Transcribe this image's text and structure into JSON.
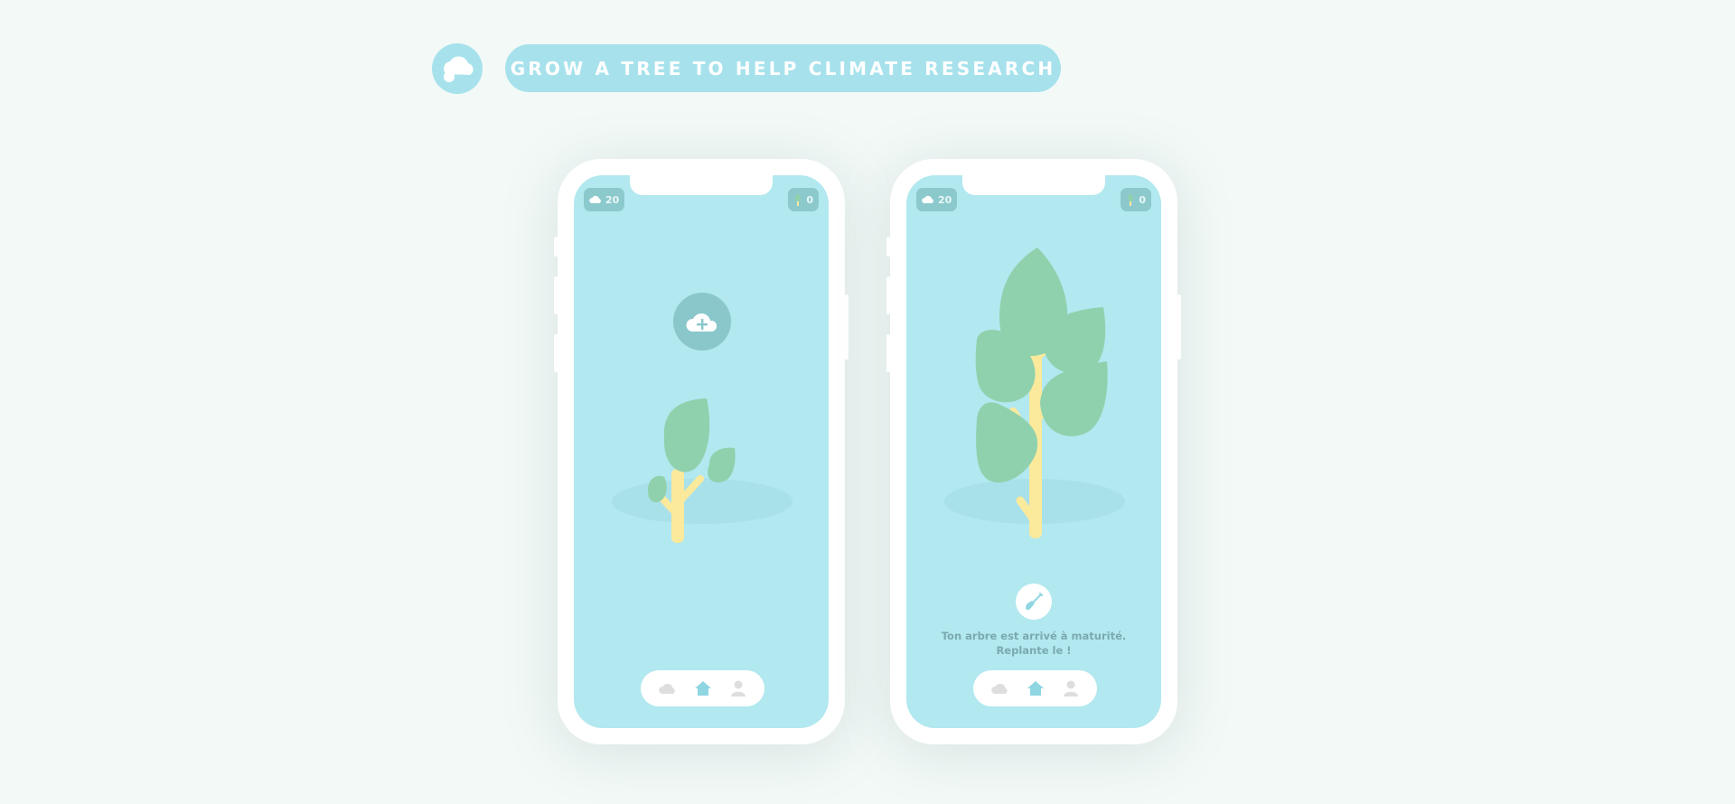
{
  "header": {
    "title": "GROW A TREE TO HELP CLIMATE RESEARCH"
  },
  "phones": [
    {
      "clouds_count": "20",
      "trees_count": "0",
      "nav": [
        "cloud-icon",
        "home-icon",
        "user-icon"
      ]
    },
    {
      "clouds_count": "20",
      "trees_count": "0",
      "message_line1": "Ton arbre est arrivé à maturité.",
      "message_line2": "Replante le !",
      "nav": [
        "cloud-icon",
        "home-icon",
        "user-icon"
      ]
    }
  ],
  "colors": {
    "background": "#f2f9f7",
    "accent": "#a7e2ec",
    "screen": "#b2e8ef",
    "leaf": "#8fd1ad",
    "trunk": "#fbe99c",
    "pill": "#8cc9cd"
  }
}
